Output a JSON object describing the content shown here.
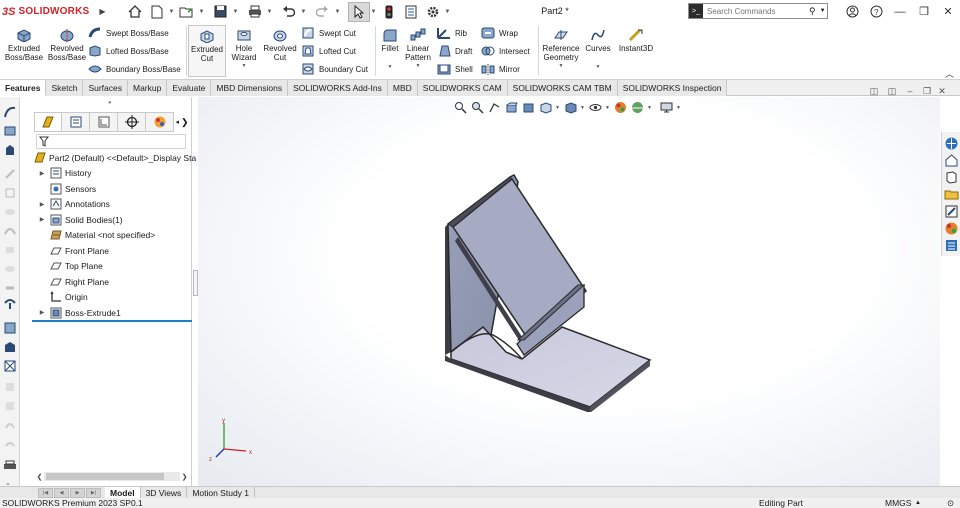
{
  "app": {
    "logo_ds": "3S",
    "logo_name": "SOLIDWORKS",
    "doc_title": "Part2 *"
  },
  "search": {
    "placeholder": "Search Commands"
  },
  "commands": {
    "extruded_boss": [
      "Extruded",
      "Boss/Base"
    ],
    "revolved_boss": [
      "Revolved",
      "Boss/Base"
    ],
    "swept_boss": "Swept Boss/Base",
    "lofted_boss": "Lofted Boss/Base",
    "boundary_boss": "Boundary Boss/Base",
    "extruded_cut": [
      "Extruded",
      "Cut"
    ],
    "hole_wizard": [
      "Hole",
      "Wizard"
    ],
    "revolved_cut": [
      "Revolved",
      "Cut"
    ],
    "swept_cut": "Swept Cut",
    "lofted_cut": "Lofted Cut",
    "boundary_cut": "Boundary Cut",
    "fillet": "Fillet",
    "linear_pattern": [
      "Linear",
      "Pattern"
    ],
    "rib": "Rib",
    "draft": "Draft",
    "shell": "Shell",
    "wrap": "Wrap",
    "intersect": "Intersect",
    "mirror": "Mirror",
    "reference_geometry": [
      "Reference",
      "Geometry"
    ],
    "curves": "Curves",
    "instant3d": "Instant3D"
  },
  "tabs": [
    "Features",
    "Sketch",
    "Surfaces",
    "Markup",
    "Evaluate",
    "MBD Dimensions",
    "SOLIDWORKS Add-Ins",
    "MBD",
    "SOLIDWORKS CAM",
    "SOLIDWORKS CAM TBM",
    "SOLIDWORKS Inspection"
  ],
  "active_tab": "Features",
  "tree": {
    "root": "Part2 (Default) <<Default>_Display Sta",
    "items": [
      {
        "label": "History",
        "expandable": true,
        "icon": "history-icon"
      },
      {
        "label": "Sensors",
        "expandable": false,
        "icon": "sensors-icon"
      },
      {
        "label": "Annotations",
        "expandable": true,
        "icon": "annotations-icon"
      },
      {
        "label": "Solid Bodies(1)",
        "expandable": true,
        "icon": "solid-bodies-icon"
      },
      {
        "label": "Material <not specified>",
        "expandable": false,
        "icon": "material-icon"
      },
      {
        "label": "Front Plane",
        "expandable": false,
        "icon": "plane-icon"
      },
      {
        "label": "Top Plane",
        "expandable": false,
        "icon": "plane-icon"
      },
      {
        "label": "Right Plane",
        "expandable": false,
        "icon": "plane-icon"
      },
      {
        "label": "Origin",
        "expandable": false,
        "icon": "origin-icon"
      },
      {
        "label": "Boss-Extrude1",
        "expandable": true,
        "icon": "boss-extrude-icon"
      }
    ]
  },
  "bottom_tabs": [
    "Model",
    "3D Views",
    "Motion Study 1"
  ],
  "active_bottom_tab": "Model",
  "status": {
    "product": "SOLIDWORKS Premium 2023 SP0.1",
    "mode": "Editing Part",
    "units": "MMGS"
  },
  "triad": {
    "x": "x",
    "y": "y",
    "z": "z"
  },
  "colors": {
    "accent": "#1f7fc4",
    "brand": "#d2232a",
    "model_face": "#c8cadb",
    "model_edge": "#2a2a2a"
  }
}
